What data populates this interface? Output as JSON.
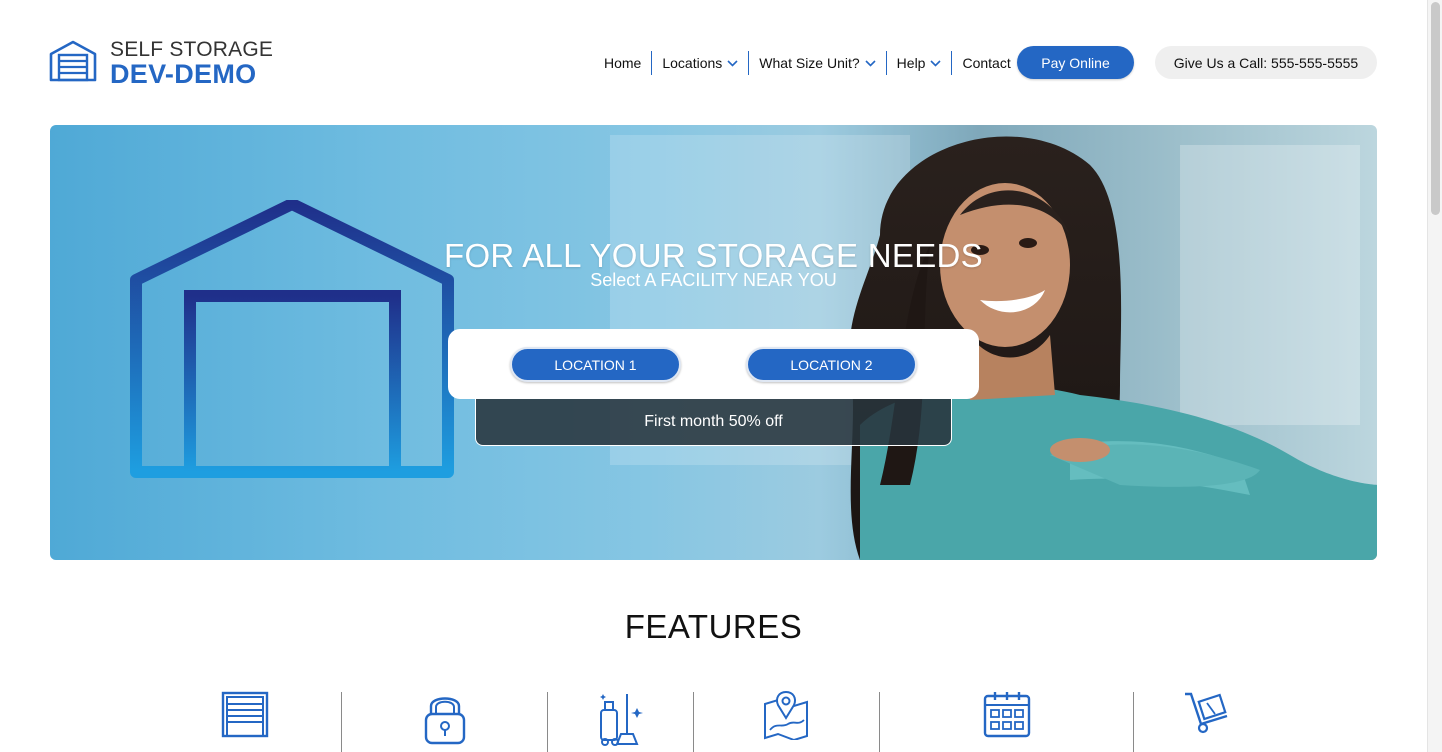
{
  "brand": {
    "line1": "SELF STORAGE",
    "line2": "DEV-DEMO",
    "accent": "#2467c4"
  },
  "nav": {
    "items": [
      {
        "label": "Home",
        "dropdown": false
      },
      {
        "label": "Locations",
        "dropdown": true
      },
      {
        "label": "What Size Unit?",
        "dropdown": true
      },
      {
        "label": "Help",
        "dropdown": true
      },
      {
        "label": "Contact",
        "dropdown": false
      }
    ],
    "pay_label": "Pay Online",
    "call_label": "Give Us a Call: 555-555-5555"
  },
  "hero": {
    "headline": "FOR ALL YOUR STORAGE NEEDS",
    "subheadline": "Select A FACILITY NEAR YOU",
    "locations": [
      "LOCATION 1",
      "LOCATION 2"
    ],
    "promo": "First month 50% off"
  },
  "features": {
    "title": "FEATURES",
    "icons": [
      "storage-door-icon",
      "padlock-icon",
      "cleaning-supplies-icon",
      "map-location-icon",
      "calendar-icon",
      "hand-truck-icon"
    ]
  }
}
